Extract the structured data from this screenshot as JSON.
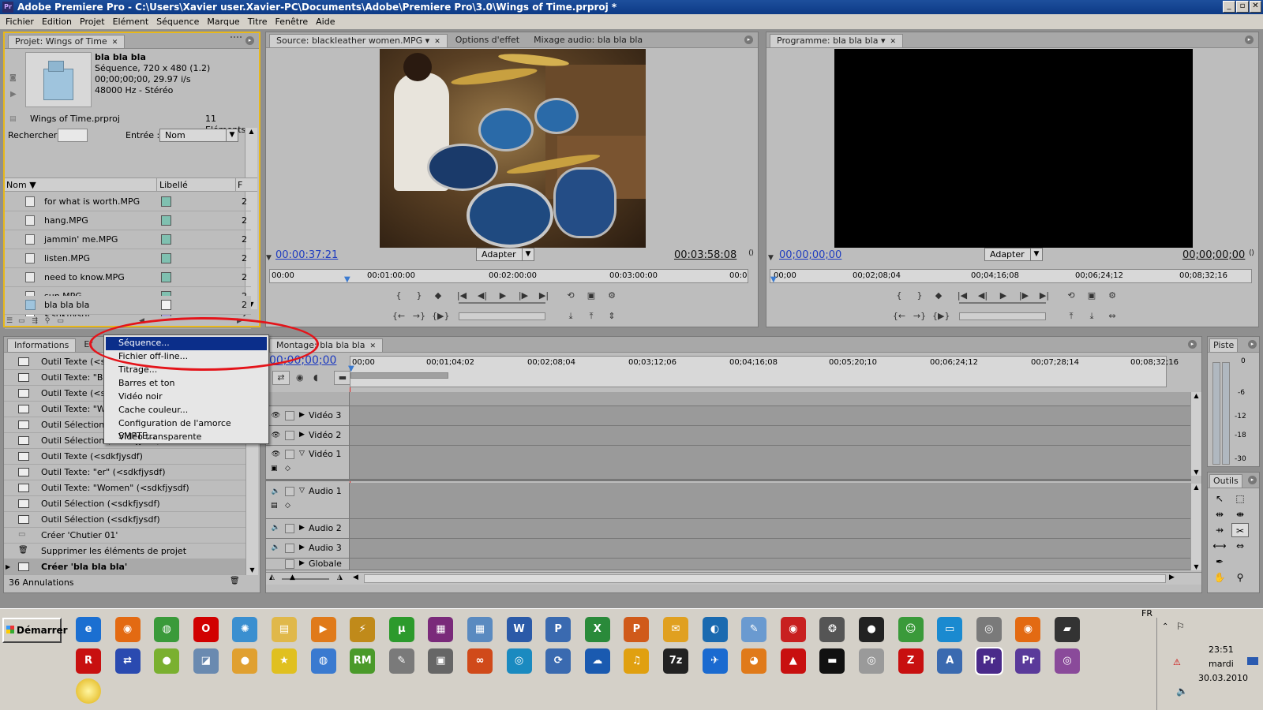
{
  "window": {
    "title": "Adobe Premiere Pro - C:\\Users\\Xavier user.Xavier-PC\\Documents\\Adobe\\Premiere Pro\\3.0\\Wings of Time.prproj *",
    "app_badge": "Pr"
  },
  "menu": [
    "Fichier",
    "Edition",
    "Projet",
    "Elément",
    "Séquence",
    "Marque",
    "Titre",
    "Fenêtre",
    "Aide"
  ],
  "project": {
    "tab": "Projet: Wings of Time",
    "preview": {
      "name": "bla bla bla",
      "info1": "Séquence, 720 x 480 (1.2)",
      "info2": "00;00;00;00, 29.97 i/s",
      "info3": "48000 Hz - Stéréo"
    },
    "file": "Wings of Time.prproj",
    "count": "11 Eléments",
    "search_label": "Rechercher :",
    "entry_label": "Entrée :",
    "entry_value": "Nom",
    "col_name": "Nom",
    "col_label": "Libellé",
    "col_f": "F",
    "items": [
      {
        "name": "for what is worth.MPG",
        "cut": "2"
      },
      {
        "name": "hang.MPG",
        "cut": "2"
      },
      {
        "name": "jammin' me.MPG",
        "cut": "2"
      },
      {
        "name": "listen.MPG",
        "cut": "2"
      },
      {
        "name": "need to know.MPG",
        "cut": "2"
      },
      {
        "name": "sun.MPG",
        "cut": "2"
      },
      {
        "name": "<sdkfjysdf",
        "cut": "2"
      },
      {
        "name": "bla bla bla",
        "cut": "2"
      }
    ]
  },
  "source": {
    "tabs": [
      "Source: blackleather women.MPG",
      "Options d'effet",
      "Mixage audio: bla bla bla"
    ],
    "tc_current": "00:00:37:21",
    "tc_duration": "00:03:58:08",
    "fit": "Adapter",
    "ruler": [
      "00:00",
      "00:01:00:00",
      "00:02:00:00",
      "00:03:00:00",
      "00:0"
    ]
  },
  "program": {
    "tab": "Programme: bla bla bla",
    "tc_current": "00;00;00;00",
    "tc_duration": "00;00;00;00",
    "fit": "Adapter",
    "ruler": [
      "00;00",
      "00;02;08;04",
      "00;04;16;08",
      "00;06;24;12",
      "00;08;32;16"
    ]
  },
  "history": {
    "tabs": [
      "Informations",
      "Ef"
    ],
    "items": [
      "Outil Texte (<sc",
      "Outil Texte: \"Bla",
      "Outil Texte (<sc",
      "Outil Texte: \"Wo",
      "Outil Sélection (",
      "Outil Sélection (<sdkfjysdf)",
      "Outil Texte (<sdkfjysdf)",
      "Outil Texte: \"er\" (<sdkfjysdf)",
      "Outil Texte: \"Women\" (<sdkfjysdf)",
      "Outil Sélection (<sdkfjysdf)",
      "Outil Sélection (<sdkfjysdf)",
      "Créer 'Chutier 01'",
      "Supprimer les éléments de projet",
      "Créer 'bla bla bla'"
    ],
    "footer": "36 Annulations"
  },
  "context_menu": [
    "Séquence...",
    "Fichier off-line...",
    "Titrage...",
    "Barres et ton",
    "Vidéo noir",
    "Cache couleur...",
    "Configuration de l'amorce SMPTE...",
    "Vidéo transparente"
  ],
  "timeline": {
    "tab": "Montage: bla bla bla",
    "tc": "00;00;00;00",
    "ruler": [
      "00;00",
      "00;01;04;02",
      "00;02;08;04",
      "00;03;12;06",
      "00;04;16;08",
      "00;05;20;10",
      "00;06;24;12",
      "00;07;28;14",
      "00;08;32;16"
    ],
    "video_tracks": [
      "Vidéo 3",
      "Vidéo 2",
      "Vidéo 1"
    ],
    "audio_tracks": [
      "Audio 1",
      "Audio 2",
      "Audio 3",
      "Globale"
    ]
  },
  "audio_meter": {
    "tab": "Piste",
    "scale": [
      "0",
      "-6",
      "-12",
      "-18",
      "-30"
    ]
  },
  "tools": {
    "tab": "Outils"
  },
  "taskbar": {
    "start": "Démarrer",
    "lang": "FR",
    "time": "23:51",
    "day": "mardi",
    "date": "30.03.2010",
    "icons_row1": [
      {
        "name": "internet-explorer-icon",
        "glyph": "e",
        "color": "#1b6fd1"
      },
      {
        "name": "firefox-icon",
        "glyph": "◉",
        "color": "#e36a12"
      },
      {
        "name": "chrome-icon",
        "glyph": "◍",
        "color": "#3a9a3a"
      },
      {
        "name": "opera-icon",
        "glyph": "O",
        "color": "#d10000"
      },
      {
        "name": "safari-icon",
        "glyph": "✺",
        "color": "#3a8fd0"
      },
      {
        "name": "folder-icon",
        "glyph": "▤",
        "color": "#e0b84a"
      },
      {
        "name": "media-player-icon",
        "glyph": "▶",
        "color": "#e07a1a"
      },
      {
        "name": "winamp-icon",
        "glyph": "⚡",
        "color": "#c08a1a"
      },
      {
        "name": "utorrent-icon",
        "glyph": "µ",
        "color": "#2c9a2c"
      },
      {
        "name": "winrar-icon",
        "glyph": "▦",
        "color": "#7a2a7a"
      },
      {
        "name": "calculator-icon",
        "glyph": "▦",
        "color": "#5a8ac0"
      },
      {
        "name": "word-icon",
        "glyph": "W",
        "color": "#2b5aa8"
      },
      {
        "name": "publisher-icon",
        "glyph": "P",
        "color": "#3a6ab0"
      },
      {
        "name": "excel-icon",
        "glyph": "X",
        "color": "#2a8a3a"
      },
      {
        "name": "powerpoint-icon",
        "glyph": "P",
        "color": "#d05a1a"
      },
      {
        "name": "outlook-icon",
        "glyph": "✉",
        "color": "#e0a020"
      },
      {
        "name": "globe-icon",
        "glyph": "◐",
        "color": "#1a6ab0"
      },
      {
        "name": "paint-icon",
        "glyph": "✎",
        "color": "#6a9ad0"
      },
      {
        "name": "burner-icon",
        "glyph": "◉",
        "color": "#c82020"
      },
      {
        "name": "film-reel-icon",
        "glyph": "❂",
        "color": "#555555"
      },
      {
        "name": "panda-icon",
        "glyph": "●",
        "color": "#222222"
      },
      {
        "name": "messenger-icon",
        "glyph": "☺",
        "color": "#3a9a3a"
      },
      {
        "name": "app-blue-icon",
        "glyph": "▭",
        "color": "#1a8ad0"
      },
      {
        "name": "film-icon",
        "glyph": "◎",
        "color": "#7a7a7a"
      },
      {
        "name": "firefox-alt-icon",
        "glyph": "◉",
        "color": "#e36a12"
      },
      {
        "name": "clapper-icon",
        "glyph": "▰",
        "color": "#333333"
      }
    ],
    "icons_row2": [
      {
        "name": "r-app-icon",
        "glyph": "R",
        "color": "#c81010"
      },
      {
        "name": "network-icon",
        "glyph": "⇄",
        "color": "#2a4ab0"
      },
      {
        "name": "green-ball-icon",
        "glyph": "●",
        "color": "#7ab030"
      },
      {
        "name": "capture-icon",
        "glyph": "◪",
        "color": "#6a8ab0"
      },
      {
        "name": "colorful-ball-icon",
        "glyph": "●",
        "color": "#e0a030"
      },
      {
        "name": "star-icon",
        "glyph": "★",
        "color": "#e0c020"
      },
      {
        "name": "network-globe-icon",
        "glyph": "◍",
        "color": "#3a7ad0"
      },
      {
        "name": "realmedia-icon",
        "glyph": "RM",
        "color": "#4a9a2a"
      },
      {
        "name": "notepad-icon",
        "glyph": "✎",
        "color": "#7a7a7a"
      },
      {
        "name": "window-app-icon",
        "glyph": "▣",
        "color": "#666666"
      },
      {
        "name": "chain-icon",
        "glyph": "∞",
        "color": "#d04a1a"
      },
      {
        "name": "cd-burn-icon",
        "glyph": "◎",
        "color": "#1a8ac0"
      },
      {
        "name": "refresh-icon",
        "glyph": "⟳",
        "color": "#3a6ab0"
      },
      {
        "name": "chat-icon",
        "glyph": "☁",
        "color": "#1a5ab0"
      },
      {
        "name": "headphones-icon",
        "glyph": "♫",
        "color": "#e0a010"
      },
      {
        "name": "7zip-icon",
        "glyph": "7z",
        "color": "#222222"
      },
      {
        "name": "plane-icon",
        "glyph": "✈",
        "color": "#1a6ad0"
      },
      {
        "name": "palette-icon",
        "glyph": "◕",
        "color": "#e07a1a"
      },
      {
        "name": "acrobat-icon",
        "glyph": "▲",
        "color": "#c81010"
      },
      {
        "name": "console-icon",
        "glyph": "▬",
        "color": "#111111"
      },
      {
        "name": "disc-icon",
        "glyph": "◎",
        "color": "#9a9a9a"
      },
      {
        "name": "filezilla-icon",
        "glyph": "Z",
        "color": "#c81010"
      },
      {
        "name": "reader-icon",
        "glyph": "A",
        "color": "#3a6ab0"
      },
      {
        "name": "premiere-active-icon",
        "glyph": "Pr",
        "color": "#4a2a8a"
      },
      {
        "name": "premiere-icon",
        "glyph": "Pr",
        "color": "#5a3a9a"
      },
      {
        "name": "dvd-icon",
        "glyph": "◎",
        "color": "#8a4a9a"
      }
    ]
  }
}
